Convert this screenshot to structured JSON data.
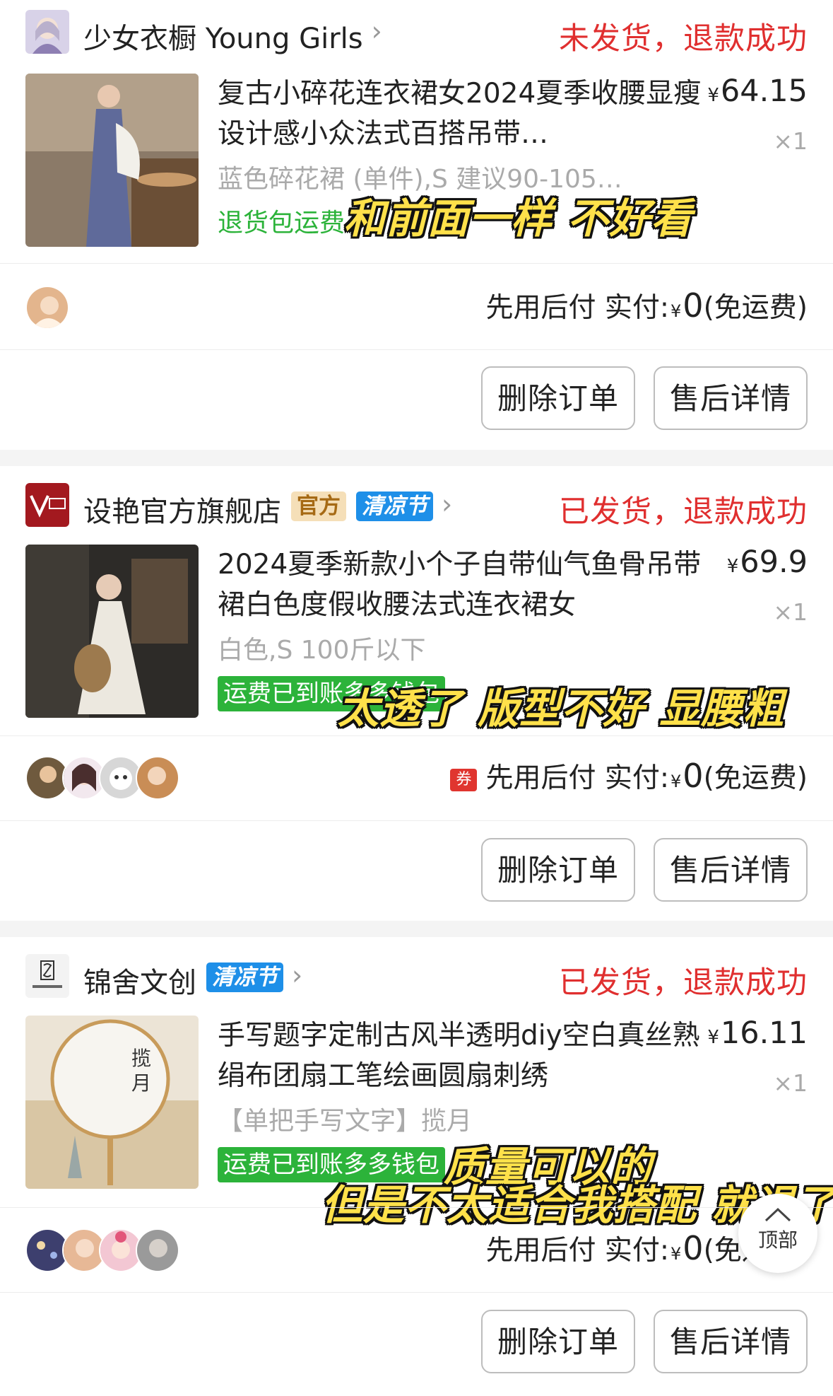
{
  "orders": [
    {
      "shop_name": "少女衣橱 Young Girls",
      "status": "未发货，退款成功",
      "title": "复古小碎花连衣裙女2024夏季收腰显瘦设计感小众法式百搭吊带…",
      "price": "64.15",
      "currency": "¥",
      "quantity": "×1",
      "spec": "蓝色碎花裙 (单件),S 建议90-105…",
      "green_note": "退货包运费",
      "pay_label": "先用后付 实付:",
      "pay_amount": "0",
      "pay_suffix": "(免运费)",
      "delete_label": "删除订单",
      "aftersale_label": "售后详情",
      "caption": "和前面一样 不好看"
    },
    {
      "shop_name": "设艳官方旗舰店",
      "tag_official": "官方",
      "tag_event": "清凉节",
      "status": "已发货，退款成功",
      "title": "2024夏季新款小个子自带仙气鱼骨吊带裙白色度假收腰法式连衣裙女",
      "price": "69.9",
      "currency": "¥",
      "quantity": "×1",
      "spec": "白色,S 100斤以下",
      "green_badge": "运费已到账多多钱包",
      "coupon_icon": "券",
      "pay_label": "先用后付 实付:",
      "pay_amount": "0",
      "pay_suffix": "(免运费)",
      "delete_label": "删除订单",
      "aftersale_label": "售后详情",
      "caption": "太透了 版型不好 显腰粗"
    },
    {
      "shop_name": "锦舍文创",
      "tag_event": "清凉节",
      "status": "已发货，退款成功",
      "title": "手写题字定制古风半透明diy空白真丝熟绢布团扇工笔绘画圆扇刺绣",
      "price": "16.11",
      "currency": "¥",
      "quantity": "×1",
      "spec": "【单把手写文字】揽月",
      "green_badge": "运费已到账多多钱包",
      "pay_label": "先用后付 实付:",
      "pay_amount": "0",
      "pay_suffix": "(免运费)",
      "delete_label": "删除订单",
      "aftersale_label": "售后详情",
      "caption_line1": "质量可以的",
      "caption_line2": "但是不太适合我搭配 就退了"
    }
  ],
  "top_button": "顶部",
  "colors": {
    "status_red": "#e02f2f",
    "green": "#2cb33a",
    "event_blue": "#1e8fe8",
    "caption_yellow": "#ffe14a"
  },
  "icons": [
    "chevron-right-icon",
    "coupon-icon",
    "arrow-up-icon"
  ]
}
